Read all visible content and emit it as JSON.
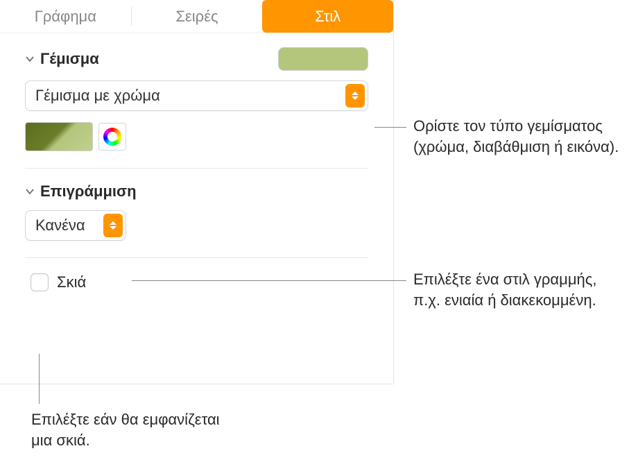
{
  "tabs": {
    "chart": "Γράφημα",
    "series": "Σειρές",
    "style": "Στιλ"
  },
  "fill": {
    "title": "Γέμισμα",
    "type_label": "Γέμισμα με χρώμα"
  },
  "stroke": {
    "title": "Επιγράμμιση",
    "value": "Κανένα"
  },
  "shadow": {
    "label": "Σκιά"
  },
  "callouts": {
    "fill_type": "Ορίστε τον τύπο γεμίσματος (χρώμα, διαβάθμιση ή εικόνα).",
    "stroke_style": "Επιλέξτε ένα στιλ γραμμής, π.χ. ενιαία ή διακεκομμένη.",
    "shadow_toggle": "Επιλέξτε εάν θα εμφανίζεται μια σκιά."
  }
}
